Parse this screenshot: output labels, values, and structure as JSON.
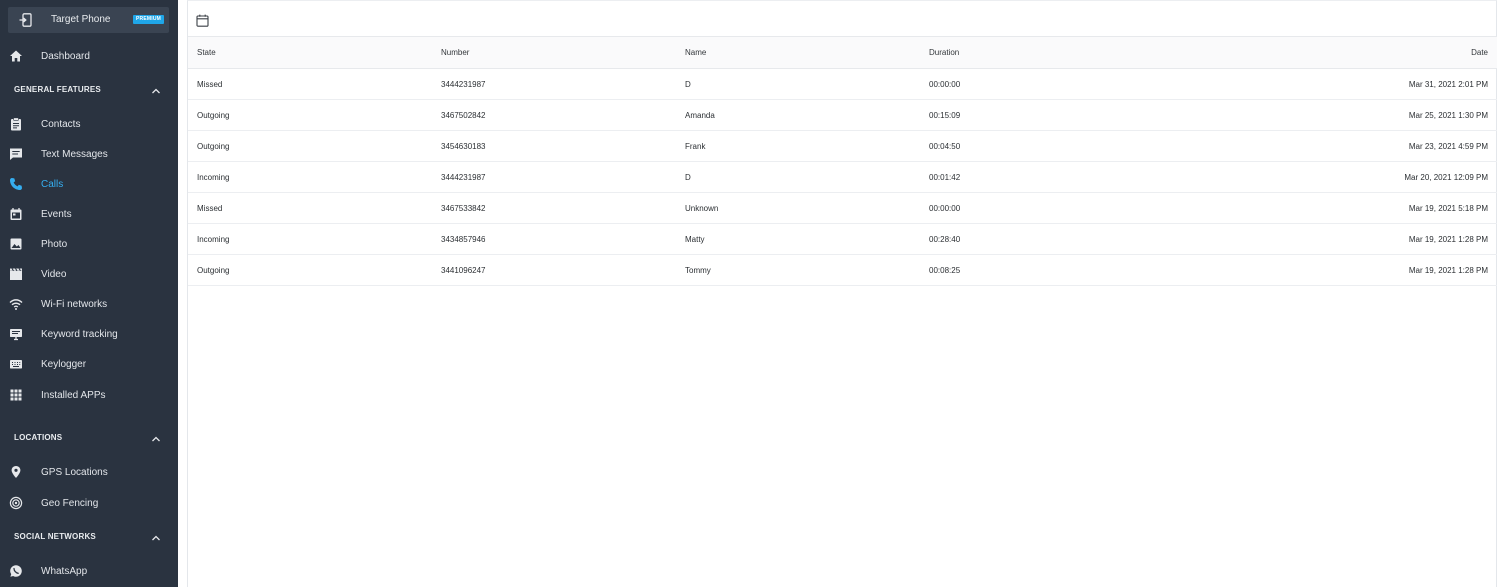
{
  "device": {
    "name": "Target Phone",
    "badge": "PREMIUM"
  },
  "nav_top": [
    {
      "label": "Dashboard",
      "icon": "home-icon"
    }
  ],
  "sections": [
    {
      "title": "GENERAL FEATURES",
      "items": [
        {
          "label": "Contacts",
          "icon": "clipboard-icon"
        },
        {
          "label": "Text Messages",
          "icon": "message-icon"
        },
        {
          "label": "Calls",
          "icon": "phone-icon",
          "active": true
        },
        {
          "label": "Events",
          "icon": "calendar-icon"
        },
        {
          "label": "Photo",
          "icon": "image-icon"
        },
        {
          "label": "Video",
          "icon": "film-icon"
        },
        {
          "label": "Wi-Fi networks",
          "icon": "wifi-icon"
        },
        {
          "label": "Keyword tracking",
          "icon": "monitor-icon"
        },
        {
          "label": "Keylogger",
          "icon": "keyboard-icon"
        },
        {
          "label": "Installed APPs",
          "icon": "grid-icon"
        }
      ]
    },
    {
      "title": "LOCATIONS",
      "items": [
        {
          "label": "GPS Locations",
          "icon": "pin-icon"
        },
        {
          "label": "Geo Fencing",
          "icon": "target-icon"
        }
      ]
    },
    {
      "title": "SOCIAL NETWORKS",
      "items": [
        {
          "label": "WhatsApp",
          "icon": "whatsapp-icon"
        }
      ]
    }
  ],
  "table": {
    "headers": {
      "state": "State",
      "number": "Number",
      "name": "Name",
      "duration": "Duration",
      "date": "Date"
    },
    "rows": [
      {
        "state": "Missed",
        "number": "3444231987",
        "name": "D",
        "duration": "00:00:00",
        "date": "Mar 31, 2021 2:01 PM"
      },
      {
        "state": "Outgoing",
        "number": "3467502842",
        "name": "Amanda",
        "duration": "00:15:09",
        "date": "Mar 25, 2021 1:30 PM"
      },
      {
        "state": "Outgoing",
        "number": "3454630183",
        "name": "Frank",
        "duration": "00:04:50",
        "date": "Mar 23, 2021 4:59 PM"
      },
      {
        "state": "Incoming",
        "number": "3444231987",
        "name": "D",
        "duration": "00:01:42",
        "date": "Mar 20, 2021 12:09 PM"
      },
      {
        "state": "Missed",
        "number": "3467533842",
        "name": "Unknown",
        "duration": "00:00:00",
        "date": "Mar 19, 2021 5:18 PM"
      },
      {
        "state": "Incoming",
        "number": "3434857946",
        "name": "Matty",
        "duration": "00:28:40",
        "date": "Mar 19, 2021 1:28 PM"
      },
      {
        "state": "Outgoing",
        "number": "3441096247",
        "name": "Tommy",
        "duration": "00:08:25",
        "date": "Mar 19, 2021 1:28 PM"
      }
    ]
  },
  "colors": {
    "sidebar_bg": "#2a3340",
    "active": "#35aef0",
    "badge": "#1fa6e8"
  }
}
